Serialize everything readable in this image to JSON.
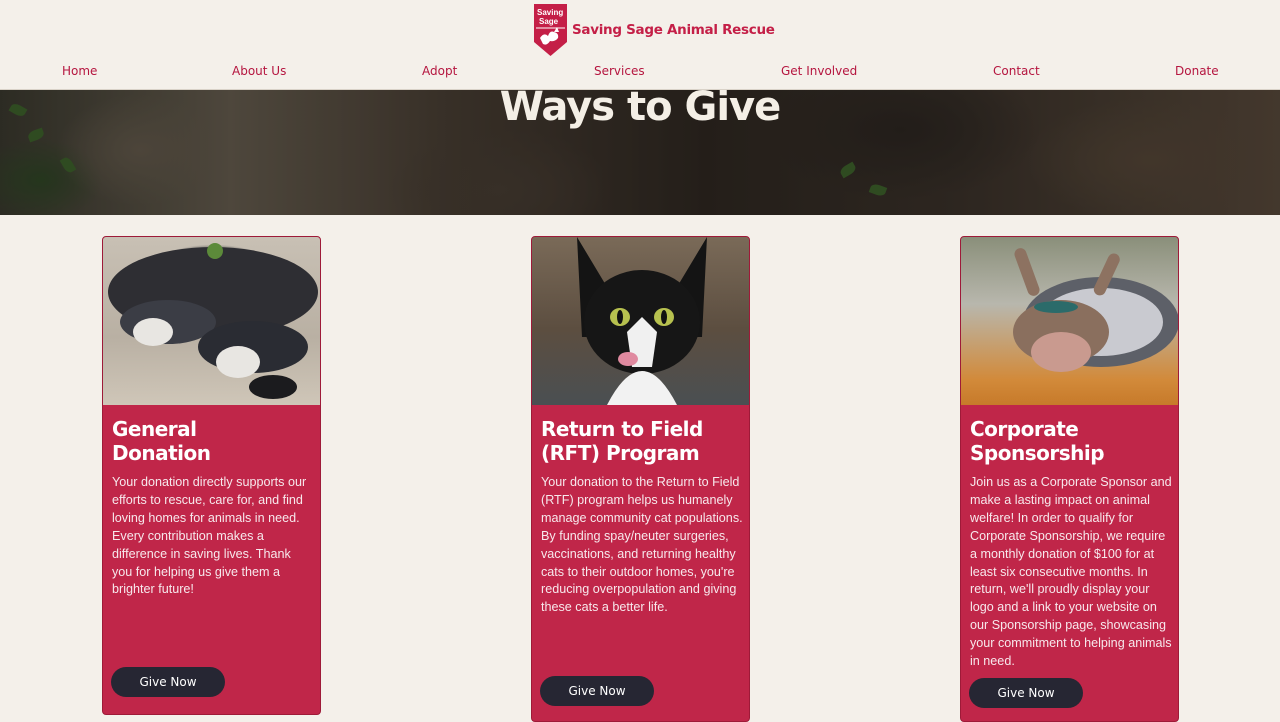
{
  "header": {
    "logo_text": "Saving Sage",
    "brand_name": "Saving Sage Animal Rescue",
    "nav": [
      "Home",
      "About Us",
      "Adopt",
      "Services",
      "Get Involved",
      "Contact",
      "Donate"
    ]
  },
  "hero": {
    "title": "Ways to Give"
  },
  "cards": [
    {
      "title_line1": "General",
      "title_line2": "Donation",
      "body": "Your donation directly supports our efforts to rescue, care for, and find loving homes for animals in need. Every contribution makes a difference in saving lives. Thank you for helping us give them a brighter future!",
      "button": "Give Now",
      "image": "two-sleeping-dogs-photo"
    },
    {
      "title_line1": "Return to Field",
      "title_line2": "(RFT) Program",
      "body": "Your donation to the Return to Field (RTF) program helps us humanely manage community cat populations. By funding spay/neuter surgeries, vaccinations, and returning healthy cats to their outdoor homes, you're reducing overpopulation and giving these cats a better life.",
      "button": "Give Now",
      "image": "tuxedo-cat-photo"
    },
    {
      "title_line1": "Corporate",
      "title_line2": "Sponsorship",
      "body": "Join us as a Corporate Sponsor and make a lasting impact on animal welfare! In order to qualify for Corporate Sponsorship, we require a monthly donation of $100 for at least six consecutive months. In return, we'll proudly display your logo and a link to your website on our Sponsorship page, showcasing your commitment to helping animals in need.",
      "button": "Give Now",
      "image": "upside-down-dog-photo"
    }
  ],
  "colors": {
    "brand": "#c41f47",
    "card": "#c02649",
    "button": "#262633",
    "background": "#f4f0ea"
  }
}
